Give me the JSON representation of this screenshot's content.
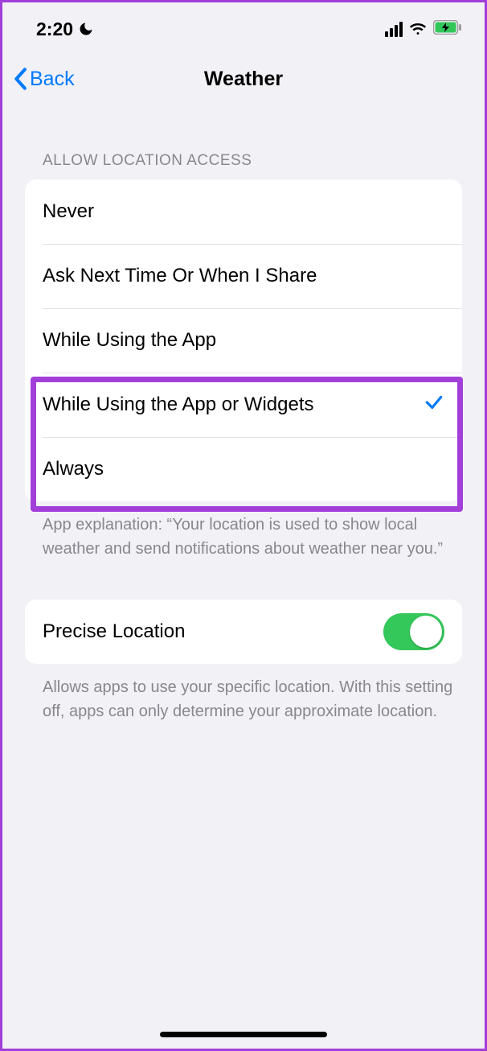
{
  "status": {
    "time": "2:20",
    "moon_icon": "moon-icon",
    "signal_icon": "cellular-signal-icon",
    "wifi_icon": "wifi-icon",
    "battery_icon": "battery-charging-icon"
  },
  "nav": {
    "back_label": "Back",
    "title": "Weather"
  },
  "location_section": {
    "header": "ALLOW LOCATION ACCESS",
    "options": [
      {
        "label": "Never",
        "selected": false
      },
      {
        "label": "Ask Next Time Or When I Share",
        "selected": false
      },
      {
        "label": "While Using the App",
        "selected": false
      },
      {
        "label": "While Using the App or Widgets",
        "selected": true
      },
      {
        "label": "Always",
        "selected": false
      }
    ],
    "footer": "App explanation: “Your location is used to show local weather and send notifications about weather near you.”"
  },
  "precise_section": {
    "label": "Precise Location",
    "enabled": true,
    "footer": "Allows apps to use your specific location. With this setting off, apps can only determine your approximate location."
  },
  "annotation": {
    "highlight_color": "#a23fd9"
  }
}
